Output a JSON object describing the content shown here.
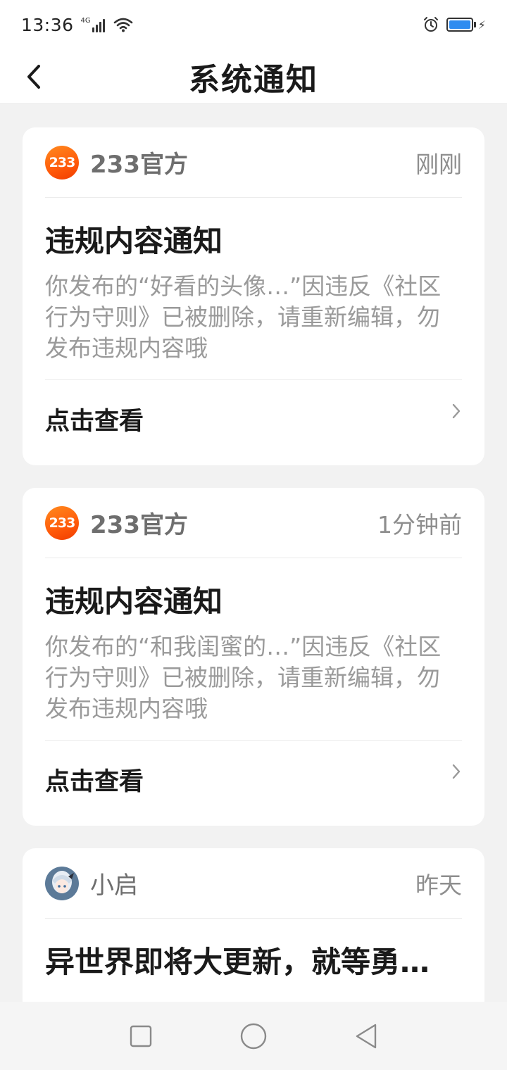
{
  "status_bar": {
    "time": "13:36",
    "network": "4G",
    "battery_color": "#2f8cf0",
    "icons": [
      "signal-icon",
      "wifi-icon",
      "alarm-icon",
      "battery-icon",
      "charging-icon"
    ]
  },
  "header": {
    "title": "系统通知",
    "back_icon": "chevron-left-icon"
  },
  "notifications": [
    {
      "sender": "233官方",
      "avatar_text": "233",
      "time": "刚刚",
      "title": "违规内容通知",
      "body": "你发布的“好看的头像…”因违反《社区行为守则》已被删除，请重新编辑，勿发布违规内容哦",
      "action": "点击查看"
    },
    {
      "sender": "233官方",
      "avatar_text": "233",
      "time": "1分钟前",
      "title": "违规内容通知",
      "body": "你发布的“和我闺蜜的…”因违反《社区行为守则》已被删除，请重新编辑，勿发布违规内容哦",
      "action": "点击查看"
    },
    {
      "sender": "小启",
      "time": "昨天",
      "title": "异世界即将大更新，就等勇…"
    }
  ],
  "nav_bar": {
    "buttons": [
      "recents-square-icon",
      "home-circle-icon",
      "back-triangle-icon"
    ]
  },
  "colors": {
    "brand_orange": "#ff6a10",
    "background": "#f2f2f2",
    "card": "#ffffff"
  }
}
